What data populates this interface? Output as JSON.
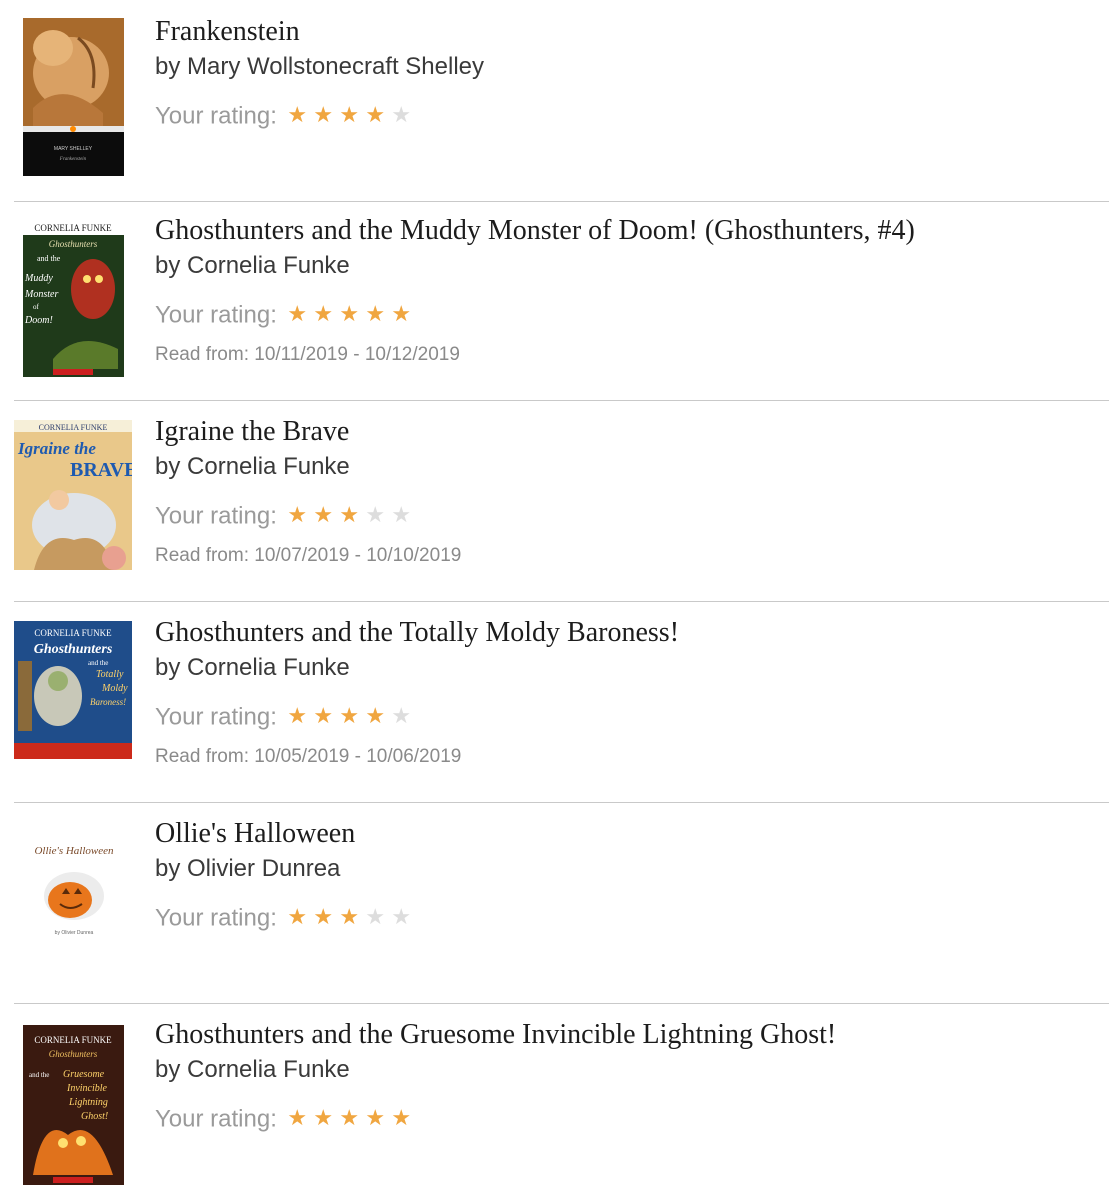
{
  "colors": {
    "star_filled": "#f0a640",
    "star_empty": "#dddddd",
    "divider": "#c9c9c9"
  },
  "rating_label": "Your rating:",
  "books": [
    {
      "title": "Frankenstein",
      "author": "by Mary Wollstonecraft Shelley",
      "rating": 4,
      "max_rating": 5,
      "read_dates": "",
      "cover_text": [
        "MARY SHELLEY",
        "Frankenstein"
      ],
      "cover_icon": "frankenstein-cover"
    },
    {
      "title": "Ghosthunters and the Muddy Monster of Doom! (Ghosthunters, #4)",
      "author": "by Cornelia Funke",
      "rating": 5,
      "max_rating": 5,
      "read_dates": "Read from: 10/11/2019 - 10/12/2019",
      "cover_text": [
        "CORNELIA FUNKE",
        "Ghosthunters",
        "and the",
        "Muddy",
        "Monster",
        "of",
        "Doom!"
      ],
      "cover_icon": "ghosthunters-muddy-cover"
    },
    {
      "title": "Igraine the Brave",
      "author": "by Cornelia Funke",
      "rating": 3,
      "max_rating": 5,
      "read_dates": "Read from: 10/07/2019 - 10/10/2019",
      "cover_text": [
        "CORNELIA FUNKE",
        "Igraine the",
        "BRAVE"
      ],
      "cover_icon": "igraine-cover"
    },
    {
      "title": "Ghosthunters and the Totally Moldy Baroness!",
      "author": "by Cornelia Funke",
      "rating": 4,
      "max_rating": 5,
      "read_dates": "Read from: 10/05/2019 - 10/06/2019",
      "cover_text": [
        "CORNELIA FUNKE",
        "Ghosthunters",
        "and the",
        "Totally",
        "Moldy",
        "Baroness!"
      ],
      "cover_icon": "ghosthunters-moldy-cover"
    },
    {
      "title": "Ollie's Halloween",
      "author": "by Olivier Dunrea",
      "rating": 3,
      "max_rating": 5,
      "read_dates": "",
      "cover_text": [
        "Ollie's Halloween",
        "by Olivier Dunrea"
      ],
      "cover_icon": "ollies-halloween-cover"
    },
    {
      "title": "Ghosthunters and the Gruesome Invincible Lightning Ghost!",
      "author": "by Cornelia Funke",
      "rating": 5,
      "max_rating": 5,
      "read_dates": "",
      "cover_text": [
        "CORNELIA FUNKE",
        "Ghosthunters",
        "and the",
        "Gruesome",
        "Invincible",
        "Lightning",
        "Ghost!"
      ],
      "cover_icon": "ghosthunters-gruesome-cover"
    }
  ]
}
